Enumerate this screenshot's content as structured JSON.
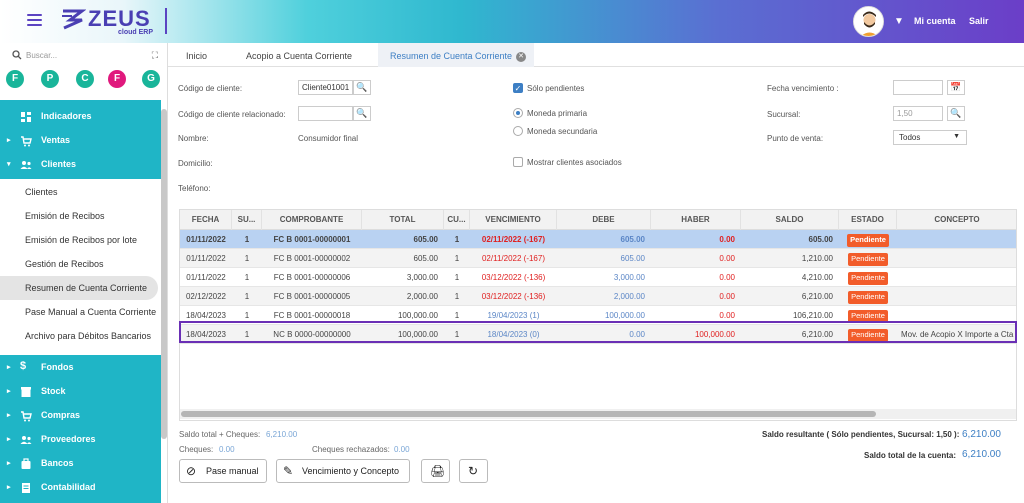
{
  "header": {
    "logo_text": "ZEUS",
    "logo_sub": "cloud ERP",
    "account_label": "Mi cuenta",
    "logout_label": "Salir"
  },
  "sidebar": {
    "search_placeholder": "Buscar...",
    "favorites": [
      {
        "letter": "F",
        "color": "#19b59a"
      },
      {
        "letter": "P",
        "color": "#19b59a"
      },
      {
        "letter": "C",
        "color": "#19b59a"
      },
      {
        "letter": "F",
        "color": "#e0197d"
      },
      {
        "letter": "G",
        "color": "#19b59a"
      }
    ],
    "top_items": [
      {
        "label": "Indicadores",
        "icon": "dashboard-icon",
        "caret": ""
      },
      {
        "label": "Ventas",
        "icon": "cart-icon",
        "caret": "▸"
      },
      {
        "label": "Clientes",
        "icon": "users-icon",
        "caret": "▾"
      }
    ],
    "clientes_sub": [
      "Clientes",
      "Emisión de Recibos",
      "Emisión de Recibos por lote",
      "Gestión de Recibos",
      "Resumen de Cuenta Corriente",
      "Pase Manual a Cuenta Corriente",
      "Archivo para Débitos Bancarios"
    ],
    "bottom_items": [
      {
        "label": "Fondos",
        "icon": "dollar-icon"
      },
      {
        "label": "Stock",
        "icon": "box-icon"
      },
      {
        "label": "Compras",
        "icon": "purchase-cart-icon"
      },
      {
        "label": "Proveedores",
        "icon": "suppliers-icon"
      },
      {
        "label": "Bancos",
        "icon": "bank-icon"
      },
      {
        "label": "Contabilidad",
        "icon": "ledger-icon"
      }
    ]
  },
  "tabs": [
    {
      "label": "Inicio"
    },
    {
      "label": "Acopio a Cuenta Corriente"
    },
    {
      "label": "Resumen de Cuenta Corriente",
      "active": true
    }
  ],
  "form": {
    "codigo_cliente_label": "Código de cliente:",
    "codigo_cliente_value": "Cliente01001",
    "codigo_relacionado_label": "Código de cliente relacionado:",
    "codigo_relacionado_value": "",
    "nombre_label": "Nombre:",
    "nombre_value": "Consumidor final",
    "domicilio_label": "Domicilio:",
    "telefono_label": "Teléfono:",
    "solo_pendientes_label": "Sólo pendientes",
    "moneda_primaria_label": "Moneda primaria",
    "moneda_secundaria_label": "Moneda secundaria",
    "mostrar_asociados_label": "Mostrar clientes asociados",
    "fecha_venc_label": "Fecha vencimiento :",
    "sucursal_label": "Sucursal:",
    "sucursal_value": "1,50",
    "punto_venta_label": "Punto de venta:",
    "punto_venta_value": "Todos"
  },
  "grid": {
    "headers": [
      "FECHA",
      "SU...",
      "COMPROBANTE",
      "TOTAL",
      "CU...",
      "VENCIMIENTO",
      "DEBE",
      "HABER",
      "SALDO",
      "ESTADO",
      "CONCEPTO"
    ],
    "rows": [
      {
        "fecha": "01/11/2022",
        "su": "1",
        "comp": "FC B 0001-00000001",
        "total": "605.00",
        "cu": "1",
        "venc": "02/11/2022 (-167)",
        "venc_color": "red",
        "debe": "605.00",
        "haber": "0.00",
        "saldo": "605.00",
        "estado": "Pendiente",
        "concepto": ""
      },
      {
        "fecha": "01/11/2022",
        "su": "1",
        "comp": "FC B 0001-00000002",
        "total": "605.00",
        "cu": "1",
        "venc": "02/11/2022 (-167)",
        "venc_color": "red",
        "debe": "605.00",
        "haber": "0.00",
        "saldo": "1,210.00",
        "estado": "Pendiente",
        "concepto": ""
      },
      {
        "fecha": "01/11/2022",
        "su": "1",
        "comp": "FC B 0001-00000006",
        "total": "3,000.00",
        "cu": "1",
        "venc": "03/12/2022 (-136)",
        "venc_color": "red",
        "debe": "3,000.00",
        "haber": "0.00",
        "saldo": "4,210.00",
        "estado": "Pendiente",
        "concepto": ""
      },
      {
        "fecha": "02/12/2022",
        "su": "1",
        "comp": "FC B 0001-00000005",
        "total": "2,000.00",
        "cu": "1",
        "venc": "03/12/2022 (-136)",
        "venc_color": "red",
        "debe": "2,000.00",
        "haber": "0.00",
        "saldo": "6,210.00",
        "estado": "Pendiente",
        "concepto": ""
      },
      {
        "fecha": "18/04/2023",
        "su": "1",
        "comp": "FC B 0001-00000018",
        "total": "100,000.00",
        "cu": "1",
        "venc": "19/04/2023 (1)",
        "venc_color": "blue",
        "debe": "100,000.00",
        "haber": "0.00",
        "saldo": "106,210.00",
        "estado": "Pendiente",
        "concepto": ""
      },
      {
        "fecha": "18/04/2023",
        "su": "1",
        "comp": "NC B 0000-00000000",
        "total": "100,000.00",
        "cu": "1",
        "venc": "18/04/2023 (0)",
        "venc_color": "blue",
        "debe": "0.00",
        "haber": "100,000.00",
        "saldo": "6,210.00",
        "estado": "Pendiente",
        "concepto": "Mov. de Acopio X Importe a Cta"
      }
    ]
  },
  "footer": {
    "saldo_total_label": "Saldo total + Cheques:",
    "saldo_total_value": "6,210.00",
    "cheques_label": "Cheques:",
    "cheques_value": "0.00",
    "cheques_rech_label": "Cheques rechazados:",
    "cheques_rech_value": "0.00",
    "saldo_resultante_label": "Saldo resultante ( Sólo pendientes, Sucursal: 1,50 ):",
    "saldo_resultante_value": "6,210.00",
    "saldo_cuenta_label": "Saldo total de la cuenta:",
    "saldo_cuenta_value": "6,210.00",
    "pase_manual_label": "Pase manual",
    "vencimiento_label": "Vencimiento y Concepto"
  },
  "colors": {
    "accent": "#1fb5c6",
    "badge": "#f25c2a",
    "highlight": "#6a2fb5"
  }
}
